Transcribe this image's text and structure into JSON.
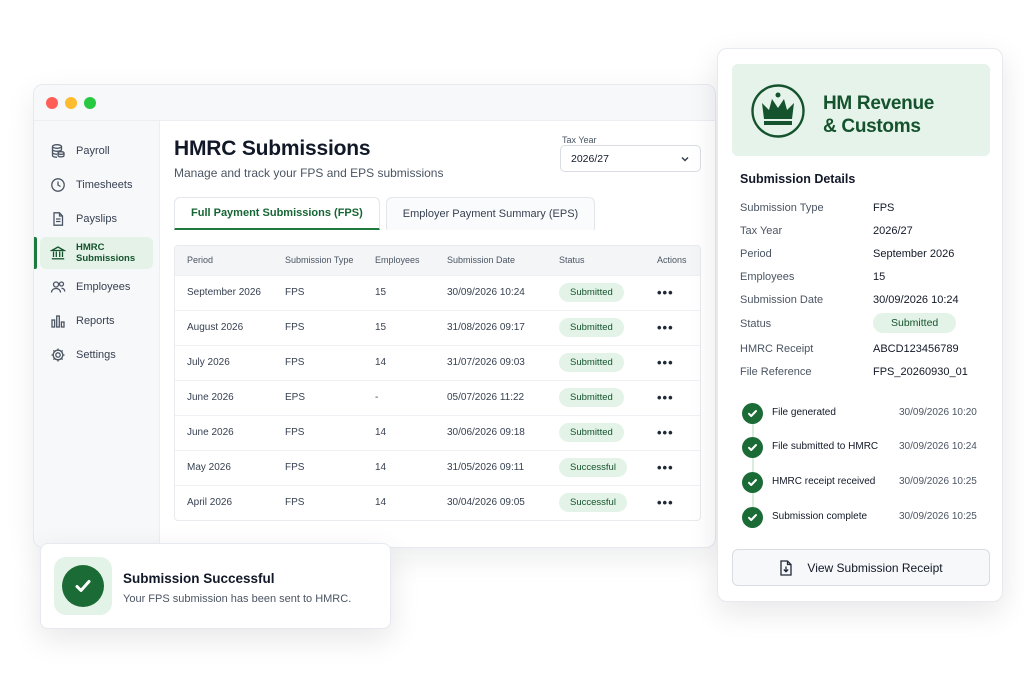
{
  "window": {
    "sidebar": {
      "items": [
        {
          "label": "Payroll",
          "icon": "coins-icon"
        },
        {
          "label": "Timesheets",
          "icon": "clock-icon"
        },
        {
          "label": "Payslips",
          "icon": "document-icon"
        },
        {
          "label": "HMRC Submissions",
          "icon": "bank-icon",
          "active": true
        },
        {
          "label": "Employees",
          "icon": "users-icon"
        },
        {
          "label": "Reports",
          "icon": "bar-chart-icon"
        },
        {
          "label": "Settings",
          "icon": "gear-icon"
        }
      ]
    },
    "header": {
      "title": "HMRC Submissions",
      "subtitle": "Manage and track your FPS and EPS submissions",
      "tax_year_label": "Tax Year",
      "tax_year_value": "2026/27"
    },
    "tabs": [
      {
        "label": "Full Payment Submissions (FPS)",
        "active": true
      },
      {
        "label": "Employer Payment Summary (EPS)",
        "active": false
      }
    ],
    "table": {
      "columns": [
        "Period",
        "Submission Type",
        "Employees",
        "Submission Date",
        "Status",
        "Actions"
      ],
      "rows": [
        [
          "September 2026",
          "FPS",
          "15",
          "30/09/2026 10:24",
          "Submitted"
        ],
        [
          "August 2026",
          "FPS",
          "15",
          "31/08/2026 09:17",
          "Submitted"
        ],
        [
          "July 2026",
          "FPS",
          "14",
          "31/07/2026 09:03",
          "Submitted"
        ],
        [
          "June 2026",
          "EPS",
          "-",
          "05/07/2026 11:22",
          "Submitted"
        ],
        [
          "June 2026",
          "FPS",
          "14",
          "30/06/2026 09:18",
          "Submitted"
        ],
        [
          "May 2026",
          "FPS",
          "14",
          "31/05/2026 09:11",
          "Successful"
        ],
        [
          "April 2026",
          "FPS",
          "14",
          "30/04/2026 09:05",
          "Successful"
        ]
      ],
      "actions_glyph": "•••"
    }
  },
  "toast": {
    "title": "Submission Successful",
    "message": "Your FPS submission has been sent to HMRC."
  },
  "panel": {
    "brand_line1": "HM Revenue",
    "brand_line2": "& Customs",
    "title": "Submission Details",
    "details": [
      {
        "key": "Submission Type",
        "value": "FPS"
      },
      {
        "key": "Tax Year",
        "value": "2026/27"
      },
      {
        "key": "Period",
        "value": "September 2026"
      },
      {
        "key": "Employees",
        "value": "15"
      },
      {
        "key": "Submission Date",
        "value": "30/09/2026 10:24"
      },
      {
        "key": "Status",
        "value": "Submitted"
      },
      {
        "key": "HMRC Receipt",
        "value": "ABCD123456789"
      },
      {
        "key": "File Reference",
        "value": "FPS_20260930_01"
      }
    ],
    "timeline": [
      {
        "label": "File generated",
        "time": "30/09/2026 10:20"
      },
      {
        "label": "File submitted to HMRC",
        "time": "30/09/2026 10:24"
      },
      {
        "label": "HMRC receipt received",
        "time": "30/09/2026 10:25"
      },
      {
        "label": "Submission complete",
        "time": "30/09/2026 10:25"
      }
    ],
    "button_label": "View Submission Receipt"
  },
  "colors": {
    "brand_green": "#1b6b36",
    "badge_bg": "#e3f3e7",
    "panel_brand_bg": "#e6f3ea"
  }
}
